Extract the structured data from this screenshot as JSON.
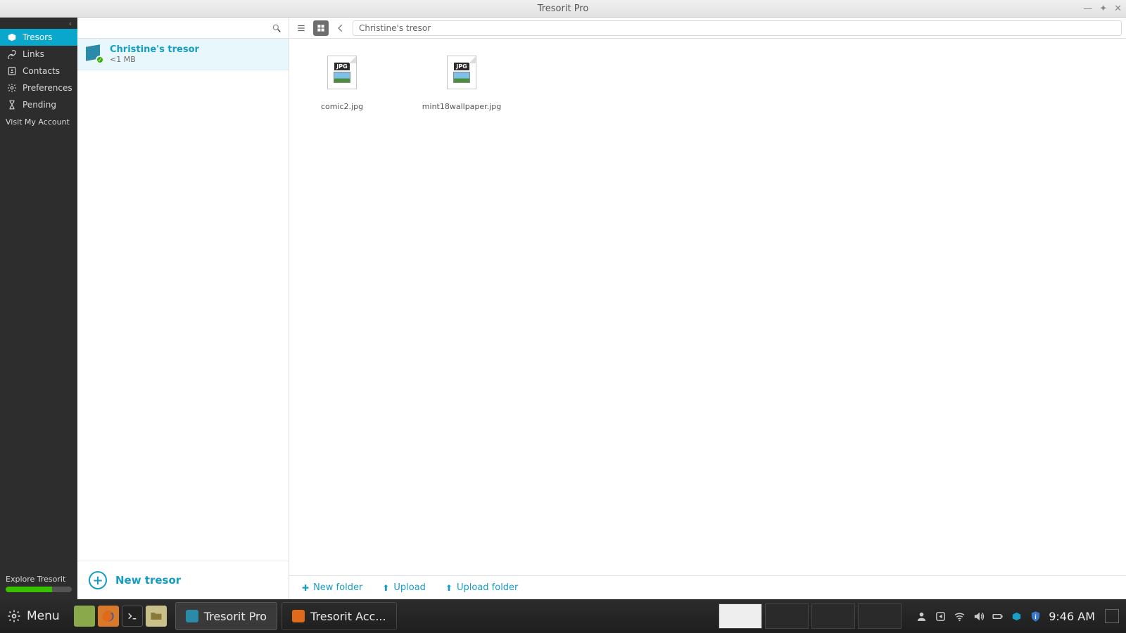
{
  "window": {
    "title": "Tresorit Pro"
  },
  "sidebar": {
    "items": [
      {
        "label": "Tresors"
      },
      {
        "label": "Links"
      },
      {
        "label": "Contacts"
      },
      {
        "label": "Preferences"
      },
      {
        "label": "Pending"
      }
    ],
    "visit_account": "Visit My Account",
    "explore": "Explore Tresorit"
  },
  "tresor_list": {
    "selected": {
      "name": "Christine's tresor",
      "size": "<1 MB"
    },
    "new_tresor_label": "New tresor"
  },
  "toolbar": {
    "breadcrumb": "Christine's tresor"
  },
  "files": [
    {
      "name": "comic2.jpg",
      "tag": "JPG"
    },
    {
      "name": "mint18wallpaper.jpg",
      "tag": "JPG"
    }
  ],
  "content_actions": {
    "new_folder": "New folder",
    "upload": "Upload",
    "upload_folder": "Upload folder"
  },
  "taskbar": {
    "menu_label": "Menu",
    "apps": [
      {
        "label": "Tresorit Pro"
      },
      {
        "label": "Tresorit Acc..."
      }
    ],
    "clock": "9:46 AM"
  }
}
